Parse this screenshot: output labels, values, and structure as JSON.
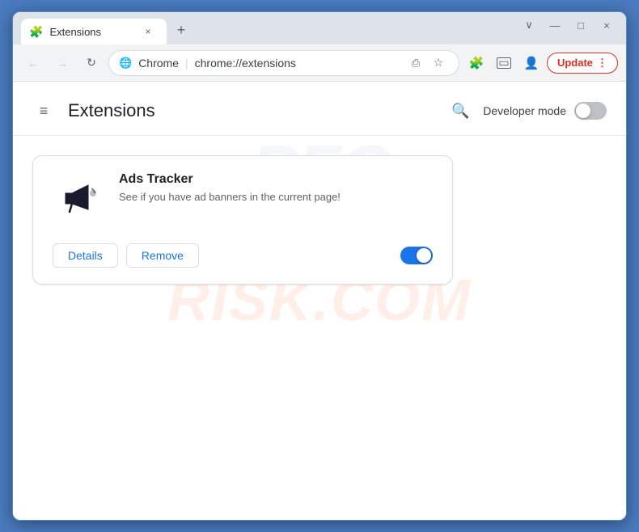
{
  "window": {
    "title": "Extensions",
    "favicon": "🧩",
    "close_label": "×",
    "minimize_label": "—",
    "maximize_label": "□",
    "chevron_down": "∨"
  },
  "tab": {
    "label": "Extensions",
    "close": "×"
  },
  "new_tab_btn": "+",
  "toolbar": {
    "back_icon": "←",
    "forward_icon": "→",
    "reload_icon": "↻",
    "browser_name": "Chrome",
    "url": "chrome://extensions",
    "share_icon": "⎙",
    "star_icon": "☆",
    "extension_icon": "🧩",
    "sidebar_icon": "▭",
    "profile_icon": "👤",
    "update_label": "Update",
    "menu_icon": "⋮"
  },
  "extensions_page": {
    "hamburger": "≡",
    "title": "Extensions",
    "search_title": "Search extensions",
    "dev_mode_label": "Developer mode"
  },
  "watermark_top": "PFC",
  "watermark_bottom": "RISK.COM",
  "extension_card": {
    "name": "Ads Tracker",
    "description": "See if you have ad banners in the current page!",
    "details_btn": "Details",
    "remove_btn": "Remove",
    "enabled": true
  }
}
